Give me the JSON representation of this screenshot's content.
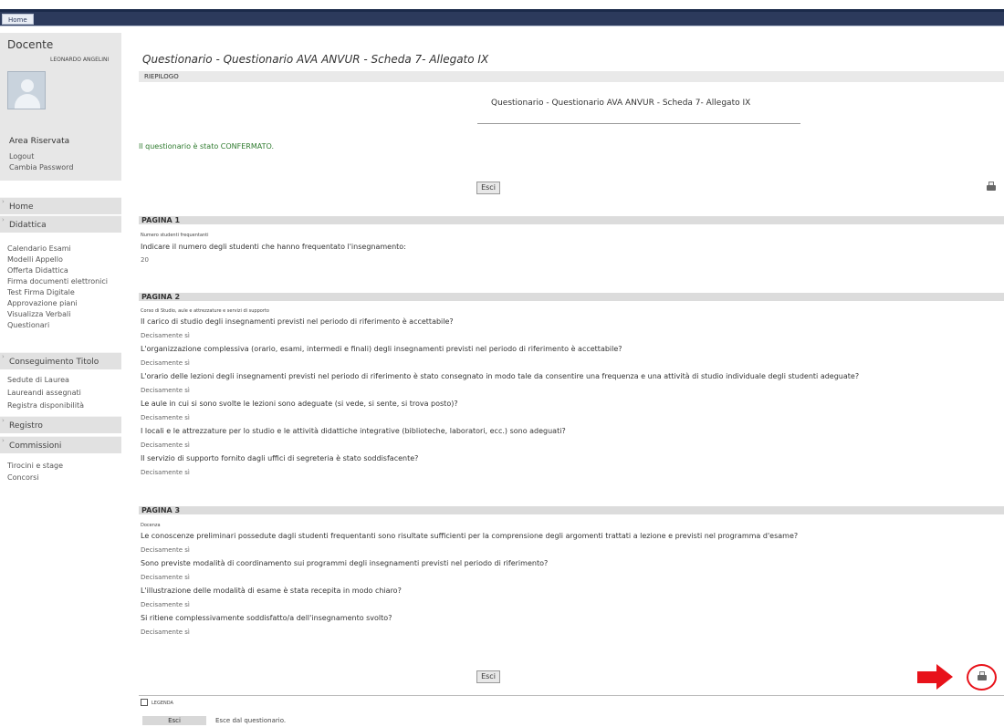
{
  "topbar": {
    "home_tab": "Home"
  },
  "sidebar": {
    "role": "Docente",
    "user_name": "LEONARDO ANGELINI",
    "area_title": "Area Riservata",
    "area_links": [
      "Logout",
      "Cambia Password"
    ],
    "sections": [
      {
        "label": "Home",
        "items": []
      },
      {
        "label": "Didattica",
        "items": [
          "Calendario Esami",
          "Modelli Appello",
          "Offerta Didattica",
          "Firma documenti elettronici",
          "Test Firma Digitale",
          "Approvazione piani",
          "Visualizza Verbali",
          "Questionari"
        ]
      },
      {
        "label": "Conseguimento Titolo",
        "items": [
          "Sedute di Laurea",
          "Laureandi assegnati",
          "Registra disponibilità"
        ]
      },
      {
        "label": "Registro",
        "items": []
      },
      {
        "label": "Commissioni",
        "items": [
          "Tirocini e stage",
          "Concorsi"
        ]
      }
    ]
  },
  "main": {
    "page_title": "Questionario - Questionario AVA ANVUR - Scheda 7- Allegato IX",
    "riepilogo": "RIEPILOGO",
    "center_title": "Questionario - Questionario AVA ANVUR - Scheda 7- Allegato IX",
    "confirm_msg": "Il questionario è stato CONFERMATO.",
    "esci_label": "Esci",
    "pages": [
      {
        "title": "PAGINA 1",
        "category": "Numero studenti frequentanti",
        "items": [
          {
            "q": "Indicare il numero degli studenti che hanno frequentato l'insegnamento:",
            "a": "20"
          }
        ]
      },
      {
        "title": "PAGINA 2",
        "category": "Corso di Studio, aule e attrezzature e servizi di supporto",
        "items": [
          {
            "q": "Il carico di studio degli insegnamenti previsti nel periodo di riferimento è accettabile?",
            "a": "Decisamente sì"
          },
          {
            "q": "L'organizzazione complessiva (orario, esami, intermedi e finali) degli insegnamenti previsti nel periodo di riferimento è accettabile?",
            "a": "Decisamente sì"
          },
          {
            "q": "L'orario delle lezioni degli insegnamenti previsti nel periodo di riferimento è stato consegnato in modo tale da consentire una frequenza e una attività di studio individuale degli studenti adeguate?",
            "a": "Decisamente sì"
          },
          {
            "q": "Le aule in cui si sono svolte le lezioni sono adeguate (si vede, si sente, si trova posto)?",
            "a": "Decisamente sì"
          },
          {
            "q": "I locali e le attrezzature per lo studio e le attività didattiche integrative (biblioteche, laboratori, ecc.) sono adeguati?",
            "a": "Decisamente sì"
          },
          {
            "q": "Il servizio di supporto fornito dagli uffici di segreteria è stato soddisfacente?",
            "a": "Decisamente sì"
          }
        ]
      },
      {
        "title": "PAGINA 3",
        "category": "Docenza",
        "items": [
          {
            "q": "Le conoscenze preliminari possedute dagli studenti frequentanti sono risultate sufficienti per la comprensione degli argomenti trattati a lezione e previsti nel programma d'esame?",
            "a": "Decisamente sì"
          },
          {
            "q": "Sono previste modalità di coordinamento sui programmi degli insegnamenti previsti nel periodo di riferimento?",
            "a": "Decisamente sì"
          },
          {
            "q": "L'illustrazione delle modalità di esame è stata recepita in modo chiaro?",
            "a": "Decisamente sì"
          },
          {
            "q": "Si ritiene complessivamente soddisfatto/a dell'insegnamento svolto?",
            "a": "Decisamente sì"
          }
        ]
      }
    ],
    "legend_title": "LEGENDA",
    "legend_btn": "Esci",
    "legend_desc": "Esce dal questionario."
  },
  "icons": [
    "printer-icon",
    "legend-icon",
    "red-arrow-annotation",
    "red-circle-annotation"
  ],
  "colors": {
    "accent_red": "#e8121a",
    "confirm_green": "#2d7a2d",
    "header_navy": "#2c3a5c"
  }
}
